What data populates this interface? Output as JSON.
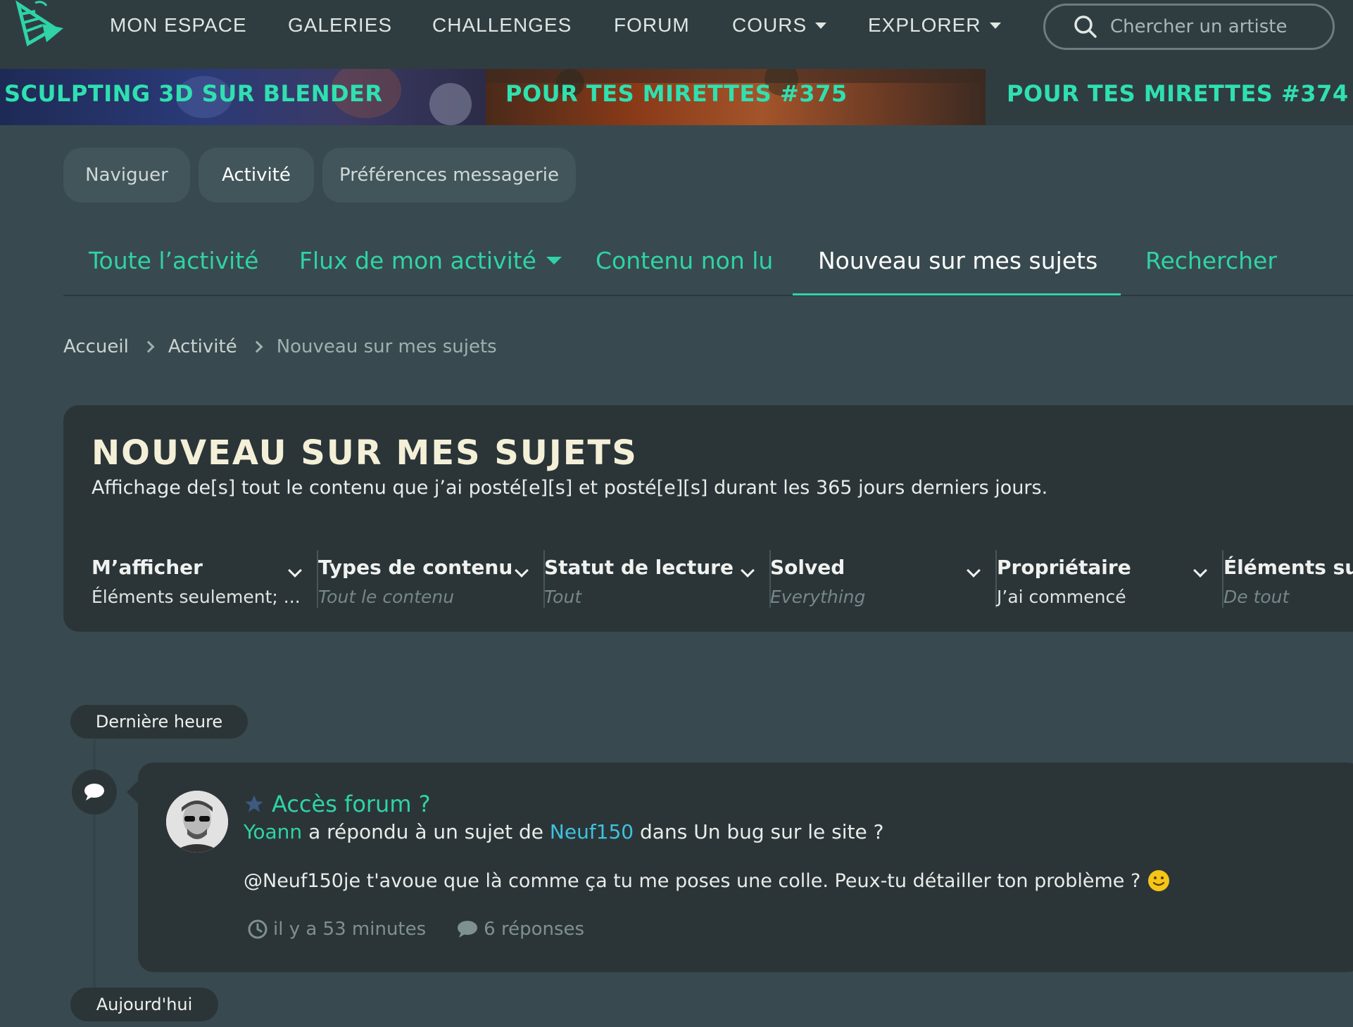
{
  "nav": {
    "items": [
      {
        "label": "MON ESPACE",
        "dropdown": false
      },
      {
        "label": "GALERIES",
        "dropdown": false
      },
      {
        "label": "CHALLENGES",
        "dropdown": false
      },
      {
        "label": "FORUM",
        "dropdown": false
      },
      {
        "label": "COURS",
        "dropdown": true
      },
      {
        "label": "EXPLORER",
        "dropdown": true
      }
    ],
    "search_placeholder": "Chercher un artiste"
  },
  "banner": {
    "items": [
      "SCULPTING 3D SUR BLENDER",
      "POUR TES MIRETTES #375",
      "POUR TES MIRETTES #374"
    ]
  },
  "pills": [
    "Naviguer",
    "Activité",
    "Préférences messagerie"
  ],
  "subtabs": [
    "Toute l’activité",
    "Flux de mon activité",
    "Contenu non lu",
    "Nouveau sur mes sujets",
    "Rechercher"
  ],
  "breadcrumb": [
    "Accueil",
    "Activité",
    "Nouveau sur mes sujets"
  ],
  "header": {
    "title": "NOUVEAU SUR MES SUJETS",
    "description": "Affichage de[s] tout le contenu que j’ai posté[e][s] et posté[e][s] durant les 365 jours derniers jours."
  },
  "filters": [
    {
      "title": "M’afficher",
      "value": "Éléments seulement; ..."
    },
    {
      "title": "Types de contenu",
      "value": "Tout le contenu"
    },
    {
      "title": "Statut de lecture",
      "value": "Tout"
    },
    {
      "title": "Solved",
      "value": "Everything"
    },
    {
      "title": "Propriétaire",
      "value": "J’ai commencé"
    },
    {
      "title": "Éléments suiv",
      "value": "De tout"
    }
  ],
  "timeline": {
    "group1": "Dernière heure",
    "group2": "Aujourd'hui"
  },
  "activity": {
    "title": "Accès forum ?",
    "author": "Yoann",
    "action": "a répondu à un sujet de",
    "target_user": "Neuf150",
    "location": "dans Un bug sur le site ?",
    "body": "@Neuf150je t'avoue que là comme ça tu me poses une colle. Peux-tu détailler ton problème ?",
    "time": "il y a 53 minutes",
    "replies": "6 réponses"
  },
  "colors": {
    "accent": "#2fd3a6",
    "background": "#384a4f",
    "card": "#2b3538",
    "nav": "#2f3d41"
  }
}
